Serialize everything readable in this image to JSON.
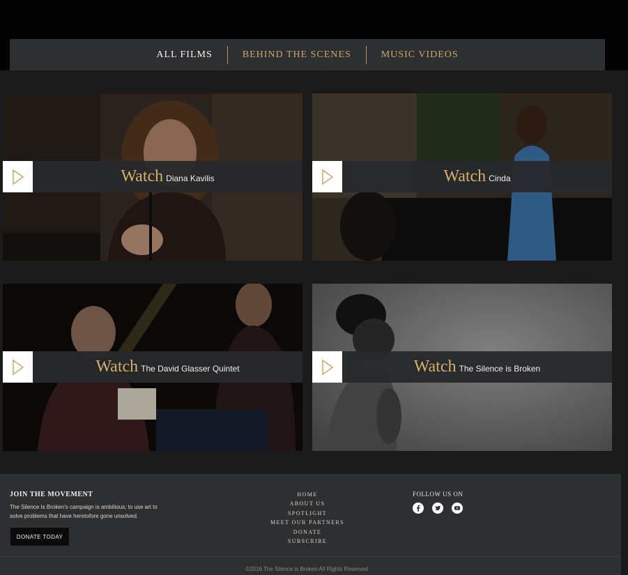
{
  "filters": {
    "items": [
      {
        "label": "ALL FILMS",
        "active": true
      },
      {
        "label": "BEHIND THE SCENES",
        "active": false
      },
      {
        "label": "MUSIC VIDEOS",
        "active": false
      }
    ]
  },
  "films": [
    {
      "watch_label": "Watch",
      "name": "Diana Kavilis"
    },
    {
      "watch_label": "Watch",
      "name": "Cinda"
    },
    {
      "watch_label": "Watch",
      "name": "The  David Glasser Quintet"
    },
    {
      "watch_label": "Watch",
      "name": "The Silence is Broken"
    }
  ],
  "footer": {
    "join_title": "JOIN THE MOVEMENT",
    "join_text": "The Silence Is Broken's campaign is ambitious; to use art to solve problems that have heretofore gone unsolved.",
    "donate_button": "DONATE TODAY",
    "nav": [
      "HOME",
      "ABOUT US",
      "SPOTLIGHT",
      "MEET OUR PARTNERS",
      "DONATE",
      "SUBSCRIBE"
    ],
    "follow_title": "FOLLOW US ON",
    "social_icons": [
      "facebook-icon",
      "twitter-icon",
      "youtube-icon"
    ],
    "copyright": "©2016 The Silence is Broken All Rights Reserved"
  },
  "colors": {
    "accent_gold": "#d4b06a",
    "bar_bg": "#2e2f31",
    "page_bg": "#1b1b1b"
  }
}
